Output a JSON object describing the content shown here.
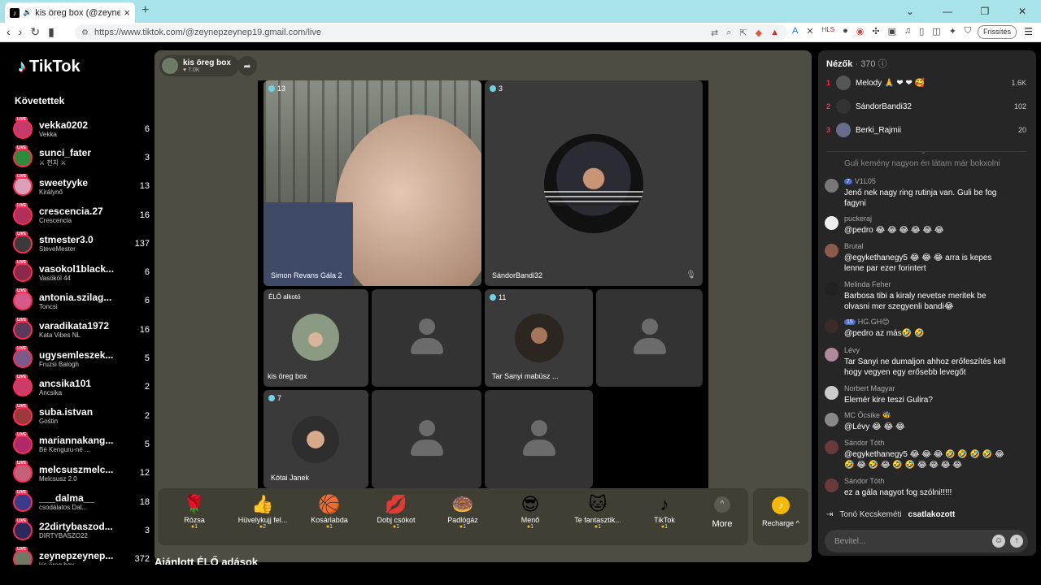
{
  "browser": {
    "tab_title": "kis öreg box (@zeynepzeyne",
    "url": "https://www.tiktok.com/@zeynepzeynep19.gmail.com/live",
    "refresh_label": "Frissítés"
  },
  "sidebar": {
    "logo": "TikTok",
    "following_title": "Követettek",
    "items": [
      {
        "name": "vekka0202",
        "sub": "Vekka",
        "count": "6"
      },
      {
        "name": "sunci_fater",
        "sub": "⚔ 천치 ⚔",
        "count": "3"
      },
      {
        "name": "sweetyyke",
        "sub": "Királynő",
        "count": "13"
      },
      {
        "name": "crescencia.27",
        "sub": "Crescencia",
        "count": "16"
      },
      {
        "name": "stmester3.0",
        "sub": "SteveMester",
        "count": "137"
      },
      {
        "name": "vasokol1black...",
        "sub": "Vasököl 44",
        "count": "6"
      },
      {
        "name": "antonia.szilag...",
        "sub": "Toncsi",
        "count": "6"
      },
      {
        "name": "varadikata1972",
        "sub": "Kata Vibes NL",
        "count": "16"
      },
      {
        "name": "ugysemleszek...",
        "sub": "Fruzsi Balogh",
        "count": "5"
      },
      {
        "name": "ancsika101",
        "sub": "Ancsika",
        "count": "2"
      },
      {
        "name": "suba.istvan",
        "sub": "Gośtin",
        "count": "2"
      },
      {
        "name": "mariannakang...",
        "sub": "Bé Kenguru-né ...",
        "count": "5"
      },
      {
        "name": "melcsuszmelc...",
        "sub": "Melcsusz 2.0",
        "count": "12"
      },
      {
        "name": "___dalma__",
        "sub": "csodálatos Dal...",
        "count": "18"
      },
      {
        "name": "22dirtybaszod...",
        "sub": "DIRTYBASZO22",
        "count": "3"
      },
      {
        "name": "zeynepzeynep...",
        "sub": "kis öreg box",
        "count": "372"
      }
    ],
    "recommended": "Ajánlott ÉLŐ adások"
  },
  "host": {
    "name": "kis öreg box",
    "likes": "♥ 7.0K"
  },
  "tiles": {
    "t1": {
      "badge": "13",
      "name": "Simon Revans Gála 2"
    },
    "t2": {
      "badge": "3",
      "name": "SándorBandi32"
    },
    "t3": {
      "badge": "ÉLŐ alkotó",
      "name": "kis öreg box"
    },
    "t4": {
      "badge": "11",
      "name": "Tar Sanyi mabüsz ..."
    },
    "t5": {
      "badge": "7",
      "name": "Kótai Janek"
    }
  },
  "gifts": [
    {
      "icon": "🌹",
      "name": "Rózsa",
      "price": "1"
    },
    {
      "icon": "👍",
      "name": "Hüvelykujj fel...",
      "price": "2"
    },
    {
      "icon": "🏀",
      "name": "Kosárlabda",
      "price": "1"
    },
    {
      "icon": "💋",
      "name": "Dobj csókot",
      "price": "1"
    },
    {
      "icon": "🍩",
      "name": "Padlógáz",
      "price": "1"
    },
    {
      "icon": "😎",
      "name": "Menő",
      "price": "1"
    },
    {
      "icon": "🐱",
      "name": "Te fantasztik...",
      "price": "1"
    },
    {
      "icon": "♪",
      "name": "TikTok",
      "price": "1"
    }
  ],
  "more_label": "More",
  "recharge_label": "Recharge ^",
  "viewers": {
    "title": "Nézők",
    "count": "· 370",
    "top": [
      {
        "rank": "1",
        "name": "Melody 🙏 ❤ ❤ 🥰",
        "value": "1.6K"
      },
      {
        "rank": "2",
        "name": "SándorBandi32",
        "value": "102"
      },
      {
        "rank": "3",
        "name": "Berki_Rajmii",
        "value": "20"
      }
    ]
  },
  "chat": {
    "faded": "Guli kemény nagyon én látam már bokxolni",
    "messages": [
      {
        "level": "7",
        "user": "V1L05",
        "text": "Jenő nek nagy ring rutinja van. Guli be fog fagyni"
      },
      {
        "level": "",
        "user": "puckeraj",
        "text": "@pedro 😂 😂 😂 😂 😂 😂"
      },
      {
        "level": "",
        "user": "Brutal",
        "text": "@egykethanegy5 😂 😂 😂 arra is kepes lenne par ezer forintert"
      },
      {
        "level": "",
        "user": "Melinda Feher",
        "text": "Barbosa tibi a kiraly nevetse meritek be olvasni mer szegyenli bandi😂"
      },
      {
        "level": "15",
        "user": "HG.GH😊",
        "text": "@pedro az más🤣 🤣"
      },
      {
        "level": "",
        "user": "Lévy",
        "text": "Tar Sanyi ne dumaljon ahhoz erőfeszítés kell hogy vegyen egy erősebb levegőt"
      },
      {
        "level": "",
        "user": "Norbert Magyar",
        "text": "Elemér kire teszi Gulira?"
      },
      {
        "level": "",
        "user": "MC Öcsike 🐝",
        "text": "@Lévy 😂 😂 😂"
      },
      {
        "level": "",
        "user": "Sándor Tóth",
        "text": "@egykethanegy5 😂 😂 😂 🤣 🤣 🤣 🤣 😂 🤣 😂 🤣 😂 🤣 🤣 😂 😂 😂 😂"
      },
      {
        "level": "",
        "user": "Sándor Tóth",
        "text": "ez a gála nagyot fog szólni!!!!!"
      }
    ],
    "joined_name": "Tonó Kecskeméti",
    "joined_text": "csatlakozott",
    "input_placeholder": "Bevitel..."
  }
}
